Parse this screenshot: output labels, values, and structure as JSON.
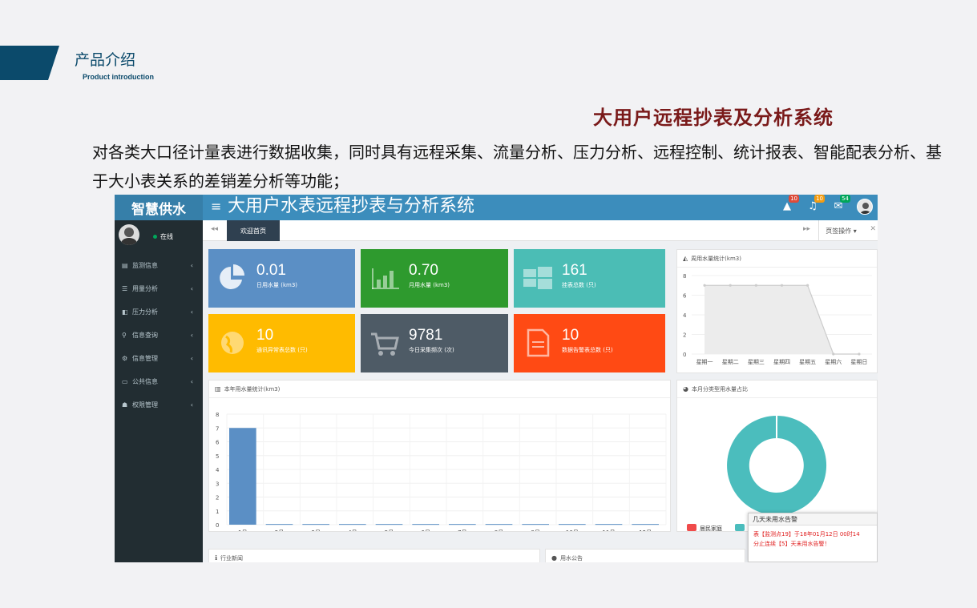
{
  "slide": {
    "title": "产品介绍",
    "subtitle": "Product introduction",
    "headline": "大用户远程抄表及分析系统",
    "intro": "对各类大口径计量表进行数据收集，同时具有远程采集、流量分析、压力分析、远程控制、统计报表、智能配表分析、基于大小表关系的差销差分析等功能；"
  },
  "app": {
    "brand": "智慧供水",
    "menu_toggle": "≡",
    "system_title": "大用户水表远程抄表与分析系统",
    "top_badges": {
      "alerts": "10",
      "notifications": "10",
      "messages": "54"
    },
    "colors": {
      "topbar": "#3c8dbc",
      "sidebar": "#222d32",
      "badge_red": "#dd4b39",
      "badge_yellow": "#f39c12",
      "badge_green": "#00a65a"
    }
  },
  "sidebar": {
    "status": "在线",
    "items": [
      {
        "icon": "monitor-icon",
        "label": "监测信息",
        "chevron": "‹"
      },
      {
        "icon": "list-icon",
        "label": "用量分析",
        "chevron": "‹"
      },
      {
        "icon": "gauge-icon",
        "label": "压力分析",
        "chevron": "‹"
      },
      {
        "icon": "search-icon",
        "label": "信息查询",
        "chevron": "‹"
      },
      {
        "icon": "gear-icon",
        "label": "信息管理",
        "chevron": "‹"
      },
      {
        "icon": "bulletin-icon",
        "label": "公共信息",
        "chevron": "‹"
      },
      {
        "icon": "user-lock-icon",
        "label": "权限管理",
        "chevron": "‹"
      }
    ]
  },
  "tabs": {
    "back": "◂◂",
    "active": "欢迎首页",
    "forward": "▸▸",
    "ops": "页签操作 ▾",
    "close": "✕"
  },
  "stats": [
    {
      "value": "0.01",
      "label": "日用水量 (km3)",
      "color": "#5b8fc5",
      "icon": "pie-chart-icon"
    },
    {
      "value": "0.70",
      "label": "月用水量 (km3)",
      "color": "#2e9a2e",
      "icon": "bar-chart-icon"
    },
    {
      "value": "161",
      "label": "挂表总数 (只)",
      "color": "#4bbdb5",
      "icon": "windows-icon"
    },
    {
      "value": "10",
      "label": "通讯异常表总数 (只)",
      "color": "#ffbb00",
      "icon": "globe-icon"
    },
    {
      "value": "9781",
      "label": "今日采集频次 (次)",
      "color": "#4e5b66",
      "icon": "cart-icon"
    },
    {
      "value": "10",
      "label": "数据告警表总数 (只)",
      "color": "#ff4a14",
      "icon": "document-icon"
    }
  ],
  "panels": {
    "weekly_title": "周用水量统计(km3)",
    "yearly_title": "本年用水量统计(km3)",
    "category_title": "本月分类型用水量占比",
    "news_title": "行业新闻",
    "notice_title": "用水公告"
  },
  "chart_data": [
    {
      "type": "area",
      "title": "周用水量统计(km3)",
      "categories": [
        "星期一",
        "星期二",
        "星期三",
        "星期四",
        "星期五",
        "星期六",
        "星期日"
      ],
      "values": [
        7,
        7,
        7,
        7,
        7,
        0,
        0
      ],
      "yticks": [
        0,
        2,
        4,
        6,
        8
      ],
      "ylim": [
        0,
        8
      ],
      "color": "#cccccc"
    },
    {
      "type": "bar",
      "title": "本年用水量统计(km3)",
      "categories": [
        "1月",
        "2月",
        "3月",
        "4月",
        "5月",
        "6月",
        "7月",
        "8月",
        "8月",
        "10月",
        "11月",
        "12月"
      ],
      "values": [
        7,
        0.05,
        0.05,
        0.05,
        0.05,
        0.05,
        0.05,
        0.05,
        0.05,
        0.05,
        0.05,
        0.05
      ],
      "yticks": [
        0,
        1,
        2,
        3,
        4,
        5,
        6,
        7,
        8
      ],
      "ylim": [
        0,
        8
      ],
      "color": "#5b8fc5"
    },
    {
      "type": "pie",
      "title": "本月分类型用水量占比",
      "slices": [
        {
          "name": "居民家庭",
          "value": 0.3,
          "color": "#f04b4b"
        },
        {
          "name": "",
          "value": 99.7,
          "color": "#4bbdbd"
        }
      ],
      "legend": "bottom-left"
    }
  ],
  "alert": {
    "title": "几天未用水告警",
    "line1": "表【监测点19】于18年01月12日 00时14",
    "line2": "分止连续【5】天未用水告警！"
  }
}
